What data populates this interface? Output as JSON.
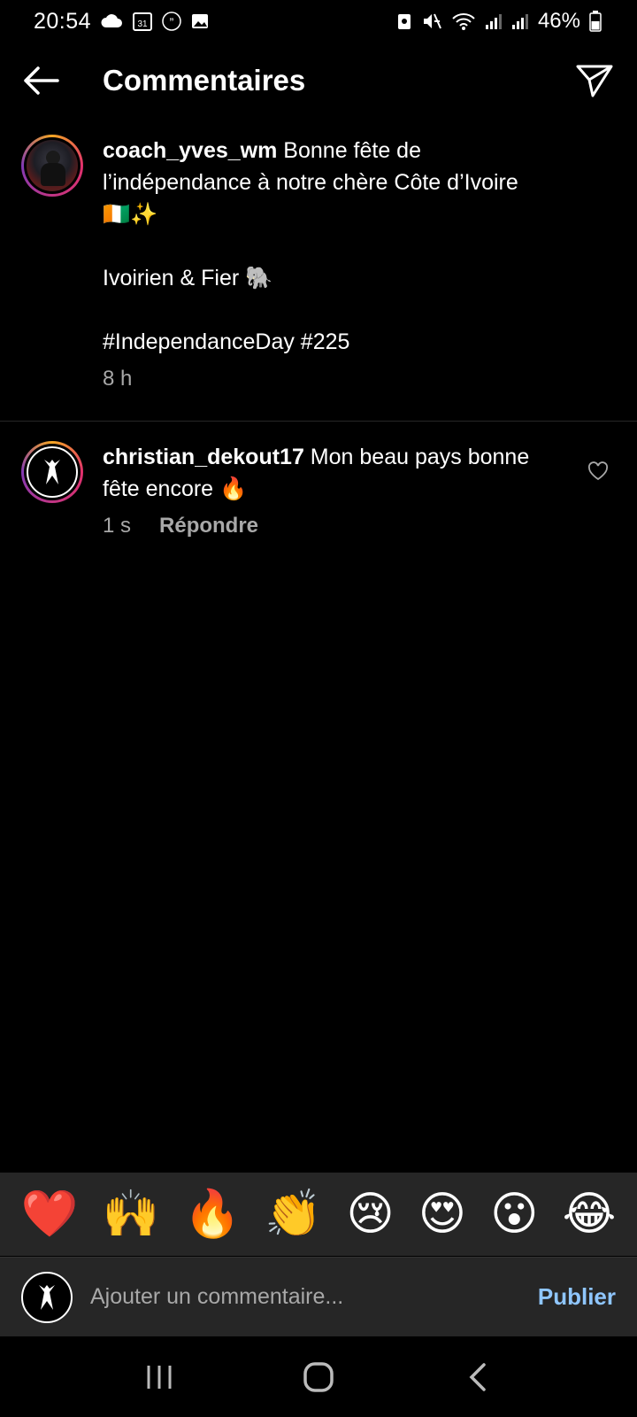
{
  "status_bar": {
    "time": "20:54",
    "battery": "46%",
    "left_icons": [
      "cloud-icon",
      "calendar-icon",
      "quote-icon",
      "image-icon"
    ],
    "right_icons": [
      "lock-icon",
      "mute-icon",
      "wifi-icon",
      "signal-icon",
      "signal-icon",
      "battery-icon"
    ],
    "calendar_day": "31"
  },
  "header": {
    "title": "Commentaires"
  },
  "caption": {
    "username": "coach_yves_wm",
    "lines": [
      " Bonne fête de",
      "l’indépendance à notre chère Côte d’Ivoire",
      "🇨🇮✨",
      "",
      "Ivoirien & Fier 🐘",
      "",
      "#IndependanceDay #225"
    ],
    "time": "8 h"
  },
  "comment": {
    "username": "christian_dekout17",
    "text_line1": " Mon beau pays bonne",
    "text_line2": "fête encore 🔥",
    "time": "1 s",
    "reply_label": "Répondre"
  },
  "emoji_bar": [
    "❤️",
    "🙌",
    "🔥",
    "👏",
    "😢",
    "😍",
    "😮",
    "😂"
  ],
  "input": {
    "placeholder": "Ajouter un commentaire...",
    "value": "",
    "publish_label": "Publier"
  },
  "colors": {
    "background": "#000000",
    "panel": "#262626",
    "secondary_text": "#a8a8a8",
    "publish": "#8fc6ff"
  }
}
